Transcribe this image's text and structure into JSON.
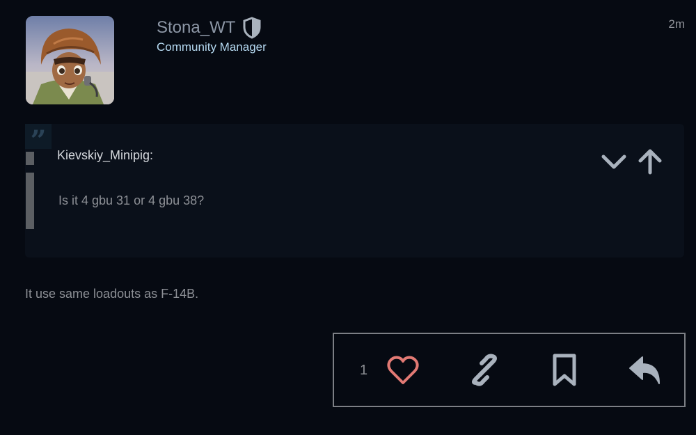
{
  "post": {
    "username": "Stona_WT",
    "user_title": "Community Manager",
    "date": "2m",
    "avatar_icon": "avatar-image",
    "moderator_icon": "shield-icon",
    "body": "It use same loadouts as F-14B."
  },
  "quote": {
    "author": "Kievskiy_Minipig:",
    "text": "Is it 4 gbu 31 or 4 gbu 38?",
    "collapse_icon": "chevron-down-icon",
    "jump_icon": "arrow-up-icon"
  },
  "actions": {
    "like_count": "1",
    "like_icon": "heart-icon",
    "link_icon": "link-icon",
    "bookmark_icon": "bookmark-icon",
    "reply_icon": "reply-icon",
    "like_color": "#e27a74",
    "icon_color": "#a9b2bd"
  },
  "colors": {
    "background": "#060a12",
    "quote_background": "#0a101a",
    "user_title": "#b6daf2"
  }
}
